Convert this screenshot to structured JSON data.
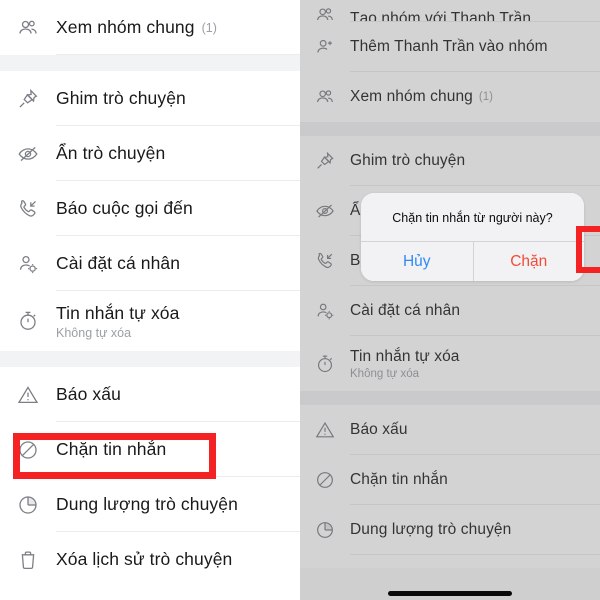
{
  "left_panel": {
    "name": "chat-options-menu",
    "rows": [
      {
        "icon": "group-people-icon",
        "title": "Xem nhóm chung",
        "count": "(1)",
        "sub": ""
      },
      {
        "icon": "pin-icon",
        "title": "Ghim trò chuyện",
        "count": "",
        "sub": ""
      },
      {
        "icon": "eye-slash-icon",
        "title": "Ẩn trò chuyện",
        "count": "",
        "sub": ""
      },
      {
        "icon": "phone-incoming-icon",
        "title": "Báo cuộc gọi đến",
        "count": "",
        "sub": ""
      },
      {
        "icon": "person-gear-icon",
        "title": "Cài đặt cá nhân",
        "count": "",
        "sub": ""
      },
      {
        "icon": "timer-icon",
        "title": "Tin nhắn tự xóa",
        "count": "",
        "sub": "Không tự xóa"
      },
      {
        "icon": "warning-triangle-icon",
        "title": "Báo xấu",
        "count": "",
        "sub": ""
      },
      {
        "icon": "block-circle-icon",
        "title": "Chặn tin nhắn",
        "count": "",
        "sub": ""
      },
      {
        "icon": "pie-chart-icon",
        "title": "Dung lượng trò chuyện",
        "count": "",
        "sub": ""
      },
      {
        "icon": "trash-icon",
        "title": "Xóa lịch sử trò chuyện",
        "count": "",
        "sub": ""
      }
    ],
    "highlight_label": "Chặn tin nhắn",
    "highlight_color": "#f42222"
  },
  "right_panel": {
    "name": "chat-options-menu-dimmed",
    "rows": [
      {
        "icon": "group-people-icon",
        "title": "Tạo nhóm với Thanh Trần",
        "count": "",
        "sub": ""
      },
      {
        "icon": "person-add-icon",
        "title": "Thêm Thanh Trần vào nhóm",
        "count": "",
        "sub": ""
      },
      {
        "icon": "group-people-icon",
        "title": "Xem nhóm chung",
        "count": "(1)",
        "sub": ""
      },
      {
        "icon": "pin-icon",
        "title": "Ghim trò chuyện",
        "count": "",
        "sub": ""
      },
      {
        "icon": "eye-slash-icon",
        "title": "Ẩn trò chuyện",
        "count": "",
        "sub": ""
      },
      {
        "icon": "phone-incoming-icon",
        "title": "Báo cuộc gọi đến",
        "count": "",
        "sub": ""
      },
      {
        "icon": "person-gear-icon",
        "title": "Cài đặt cá nhân",
        "count": "",
        "sub": ""
      },
      {
        "icon": "timer-icon",
        "title": "Tin nhắn tự xóa",
        "count": "",
        "sub": "Không tự xóa"
      },
      {
        "icon": "warning-triangle-icon",
        "title": "Báo xấu",
        "count": "",
        "sub": ""
      },
      {
        "icon": "block-circle-icon",
        "title": "Chặn tin nhắn",
        "count": "",
        "sub": ""
      },
      {
        "icon": "pie-chart-icon",
        "title": "Dung lượng trò chuyện",
        "count": "",
        "sub": ""
      },
      {
        "icon": "trash-icon",
        "title": "Xóa lịch sử trò chuyện",
        "count": "",
        "sub": ""
      }
    ]
  },
  "dialog": {
    "name": "block-messages-confirm-dialog",
    "message": "Chặn tin nhắn từ người này?",
    "cancel_label": "Hủy",
    "confirm_label": "Chặn",
    "cancel_color": "#2f8bf5",
    "confirm_color": "#f24b3a",
    "highlight_color": "#f42222"
  }
}
